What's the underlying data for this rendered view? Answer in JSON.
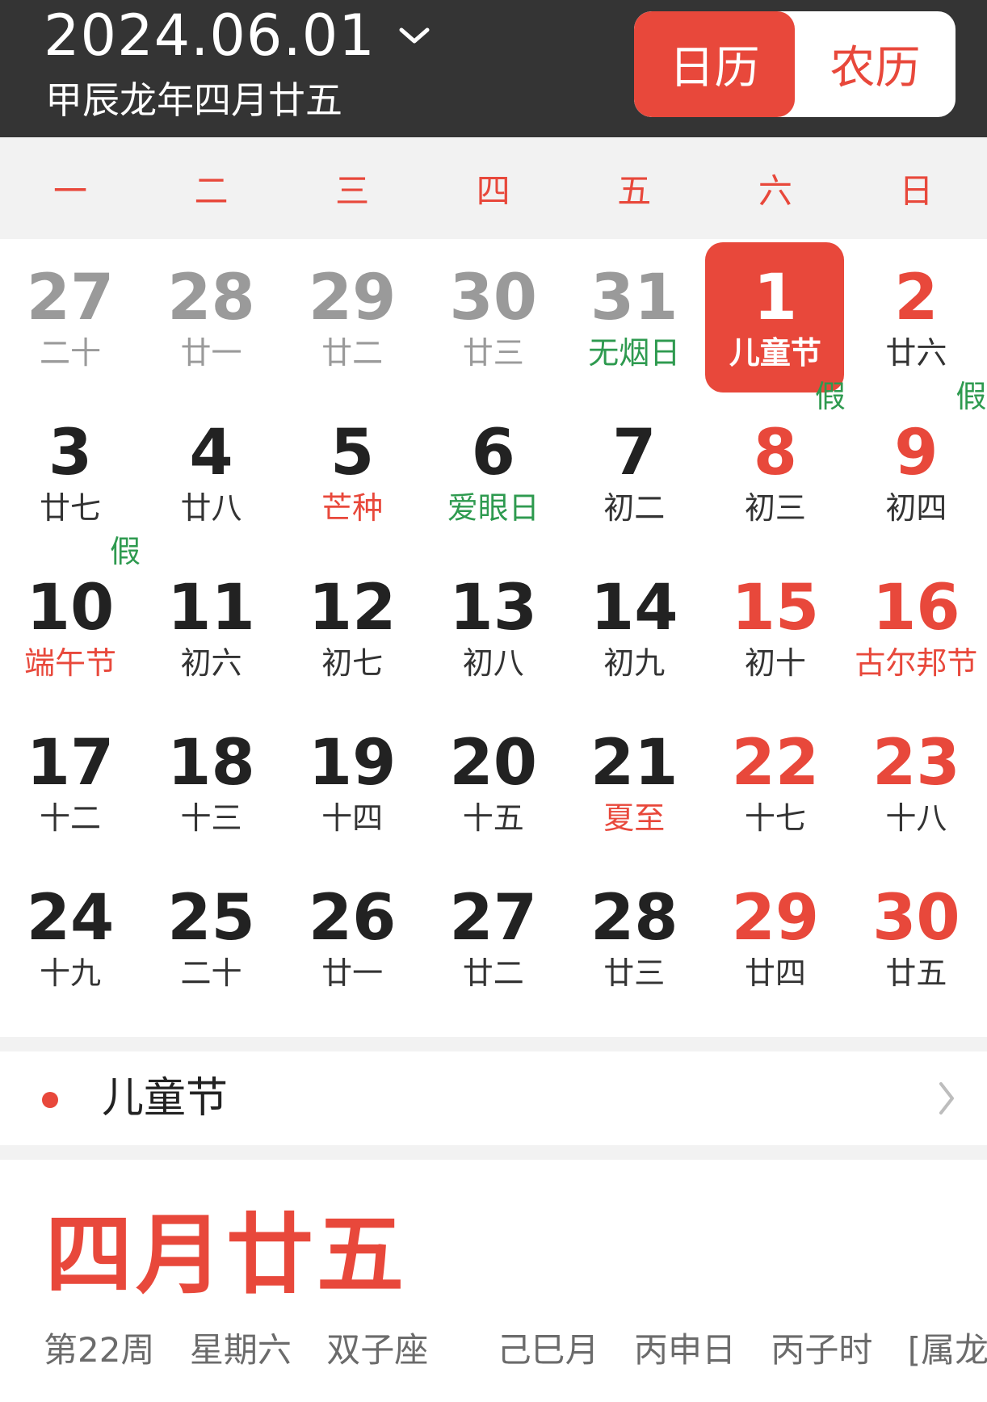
{
  "header": {
    "date": "2024.06.01",
    "lunar_subtitle": "甲辰龙年四月廿五",
    "toggle": {
      "solar_label": "日历",
      "lunar_label": "农历",
      "active": "日历"
    }
  },
  "weekdays": [
    "一",
    "二",
    "三",
    "四",
    "五",
    "六",
    "日"
  ],
  "colors": {
    "accent": "#e8483b",
    "green": "#2e9a4f",
    "header_bg": "#343434",
    "muted": "#9a9a9a"
  },
  "calendar": {
    "selected_day": "1",
    "rows": [
      [
        {
          "day": "27",
          "sub": "二十",
          "other": true
        },
        {
          "day": "28",
          "sub": "廿一",
          "other": true
        },
        {
          "day": "29",
          "sub": "廿二",
          "other": true
        },
        {
          "day": "30",
          "sub": "廿三",
          "other": true
        },
        {
          "day": "31",
          "sub": "无烟日",
          "other": true,
          "sub_color": "green"
        },
        {
          "day": "1",
          "sub": "儿童节",
          "selected": true
        },
        {
          "day": "2",
          "sub": "廿六",
          "num_color": "red"
        }
      ],
      [
        {
          "day": "3",
          "sub": "廿七"
        },
        {
          "day": "4",
          "sub": "廿八"
        },
        {
          "day": "5",
          "sub": "芒种",
          "sub_color": "red"
        },
        {
          "day": "6",
          "sub": "爱眼日",
          "sub_color": "green"
        },
        {
          "day": "7",
          "sub": "初二"
        },
        {
          "day": "8",
          "sub": "初三",
          "num_color": "red",
          "badge": "假"
        },
        {
          "day": "9",
          "sub": "初四",
          "num_color": "red",
          "badge": "假"
        }
      ],
      [
        {
          "day": "10",
          "sub": "端午节",
          "sub_color": "red",
          "badge": "假"
        },
        {
          "day": "11",
          "sub": "初六"
        },
        {
          "day": "12",
          "sub": "初七"
        },
        {
          "day": "13",
          "sub": "初八"
        },
        {
          "day": "14",
          "sub": "初九"
        },
        {
          "day": "15",
          "sub": "初十",
          "num_color": "red"
        },
        {
          "day": "16",
          "sub": "古尔邦节",
          "num_color": "red",
          "sub_color": "red"
        }
      ],
      [
        {
          "day": "17",
          "sub": "十二"
        },
        {
          "day": "18",
          "sub": "十三"
        },
        {
          "day": "19",
          "sub": "十四"
        },
        {
          "day": "20",
          "sub": "十五"
        },
        {
          "day": "21",
          "sub": "夏至",
          "sub_color": "red"
        },
        {
          "day": "22",
          "sub": "十七",
          "num_color": "red"
        },
        {
          "day": "23",
          "sub": "十八",
          "num_color": "red"
        }
      ],
      [
        {
          "day": "24",
          "sub": "十九"
        },
        {
          "day": "25",
          "sub": "二十"
        },
        {
          "day": "26",
          "sub": "廿一"
        },
        {
          "day": "27",
          "sub": "廿二"
        },
        {
          "day": "28",
          "sub": "廿三"
        },
        {
          "day": "29",
          "sub": "廿四",
          "num_color": "red"
        },
        {
          "day": "30",
          "sub": "廿五",
          "num_color": "red"
        }
      ]
    ]
  },
  "festival": {
    "label": "儿童节",
    "icon": "chevron-right-icon"
  },
  "detail": {
    "lunar_date": "四月廿五",
    "week": "第22周",
    "weekday": "星期六",
    "zodiac_sign": "双子座",
    "ganzhi_month": "己巳月",
    "ganzhi_day": "丙申日",
    "ganzhi_hour": "丙子时",
    "animal": "[属龙]"
  }
}
